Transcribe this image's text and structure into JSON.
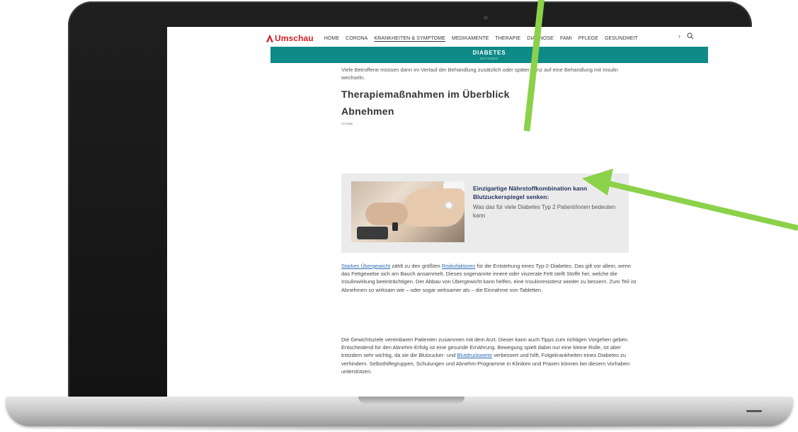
{
  "site": {
    "logo_text": "Umschau",
    "nav": [
      "HOME",
      "CORONA",
      "KRANKHEITEN & SYMPTOME",
      "MEDIKAMENTE",
      "THERAPIE",
      "DIAGNOSE",
      "FAMI",
      "PFLEGE",
      "GESUNDHEIT"
    ],
    "active_nav": "KRANKHEITEN & SYMPTOME",
    "more_icon": "chevron-right-icon",
    "search_icon": "search-icon"
  },
  "banner": {
    "title": "DIABETES",
    "subtitle": "RATGEBER",
    "color": "#0e8a87"
  },
  "article": {
    "intro_text": "Viele Betroffene müssen dann im Verlauf der Behandlung zusätzlich oder später ganz auf eine Behandlung mit Insulin wechseln.",
    "heading": "Therapiemaßnahmen im Überblick",
    "subheading": "Abnehmen",
    "ad_label": "Anzeige",
    "ad": {
      "title": "Einzigartige Nährstoffkombination kann Blutzuckerspiegel senken:",
      "desc": "Was das für viele Diabetes Typ 2 Patient/innen bedeuten kann"
    },
    "p1": {
      "link1": "Starkes Übergewicht",
      "t1": " zählt zu den größten ",
      "link2": "Risikofaktoren",
      "t2": " für die Entstehung eines Typ-2-Diabetes. Das gilt vor allem, wenn das Fettgewebe sich am Bauch ansammelt. Dieses sogenannte innere oder viszerale Fett stellt Stoffe her, welche die Insulinwirkung beeinträchtigen. Der Abbau von Übergewicht kann helfen, eine Insulinresistenz wieder zu bessern. Zum Teil ist Abnehmen so wirksam wie – oder sogar wirksamer als – die Einnahme von Tabletten."
    },
    "p2": {
      "t1": "Die Gewichtsziele vereinbaren Patienten zusammen mit dem Arzt. Dieser kann auch Tipps zum richtigen Vorgehen geben. Entscheidend für den Abnehm-Erfolg ist eine gesunde Ernährung. Bewegung spielt dabei nur eine kleine Rolle, ist aber trotzdem sehr wichtig, da sie die Blutzucker- und ",
      "link": "Blutdruckwerte",
      "t2": " verbessert und hilft, Folgekrankheiten eines Diabetes zu verhindern. Selbsthilfegruppen, Schulungen und Abnehm-Programme in Kliniken und Praxen können bei diesem Vorhaben unterstützen."
    }
  },
  "colors": {
    "logo_red": "#d2232a",
    "link_blue": "#2c6bb3",
    "ad_title": "#23365f",
    "arrow_green": "#8cd14a"
  }
}
